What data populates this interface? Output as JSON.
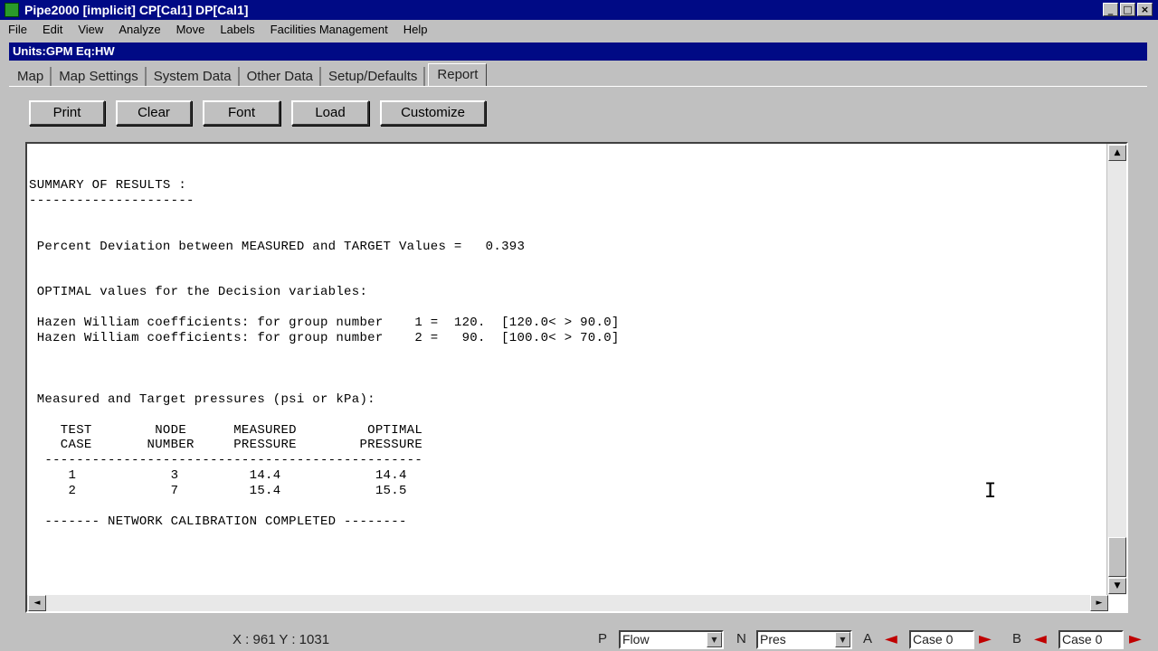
{
  "window": {
    "title": "Pipe2000  [implicit]  CP[Cal1]  DP[Cal1]",
    "controls": {
      "minimize": "_",
      "maximize": "□",
      "close": "×"
    }
  },
  "menu": {
    "items": [
      "File",
      "Edit",
      "View",
      "Analyze",
      "Move",
      "Labels",
      "Facilities Management",
      "Help"
    ]
  },
  "child_window": {
    "title": "Units:GPM  Eq:HW"
  },
  "tabs": {
    "items": [
      "Map",
      "Map Settings",
      "System Data",
      "Other Data",
      "Setup/Defaults",
      "Report"
    ],
    "active": "Report"
  },
  "toolbar": {
    "print": "Print",
    "clear": "Clear",
    "font": "Font",
    "load": "Load",
    "customize": "Customize"
  },
  "report": {
    "text": "SUMMARY OF RESULTS :\n---------------------\n\n\n Percent Deviation between MEASURED and TARGET Values =   0.393\n\n\n OPTIMAL values for the Decision variables:\n\n Hazen William coefficients: for group number    1 =  120.  [120.0< > 90.0]\n Hazen William coefficients: for group number    2 =   90.  [100.0< > 70.0]\n\n\n\n Measured and Target pressures (psi or kPa):\n\n    TEST        NODE      MEASURED         OPTIMAL\n    CASE       NUMBER     PRESSURE        PRESSURE\n  ------------------------------------------------\n     1            3         14.4            14.4\n     2            7         15.4            15.5\n\n  ------- NETWORK CALIBRATION COMPLETED --------"
  },
  "status": {
    "coords": "X : 961  Y : 1031",
    "p_label": "P",
    "p_value": "Flow",
    "n_label": "N",
    "n_value": "Pres",
    "a_label": "A",
    "a_case": "Case 0",
    "b_label": "B",
    "b_case": "Case 0"
  },
  "icons": {
    "scroll_up": "scroll-up-arrow-icon",
    "scroll_down": "scroll-down-arrow-icon",
    "scroll_left": "scroll-left-arrow-icon",
    "scroll_right": "scroll-right-arrow-icon",
    "text_cursor": "ibeam-cursor-icon"
  }
}
